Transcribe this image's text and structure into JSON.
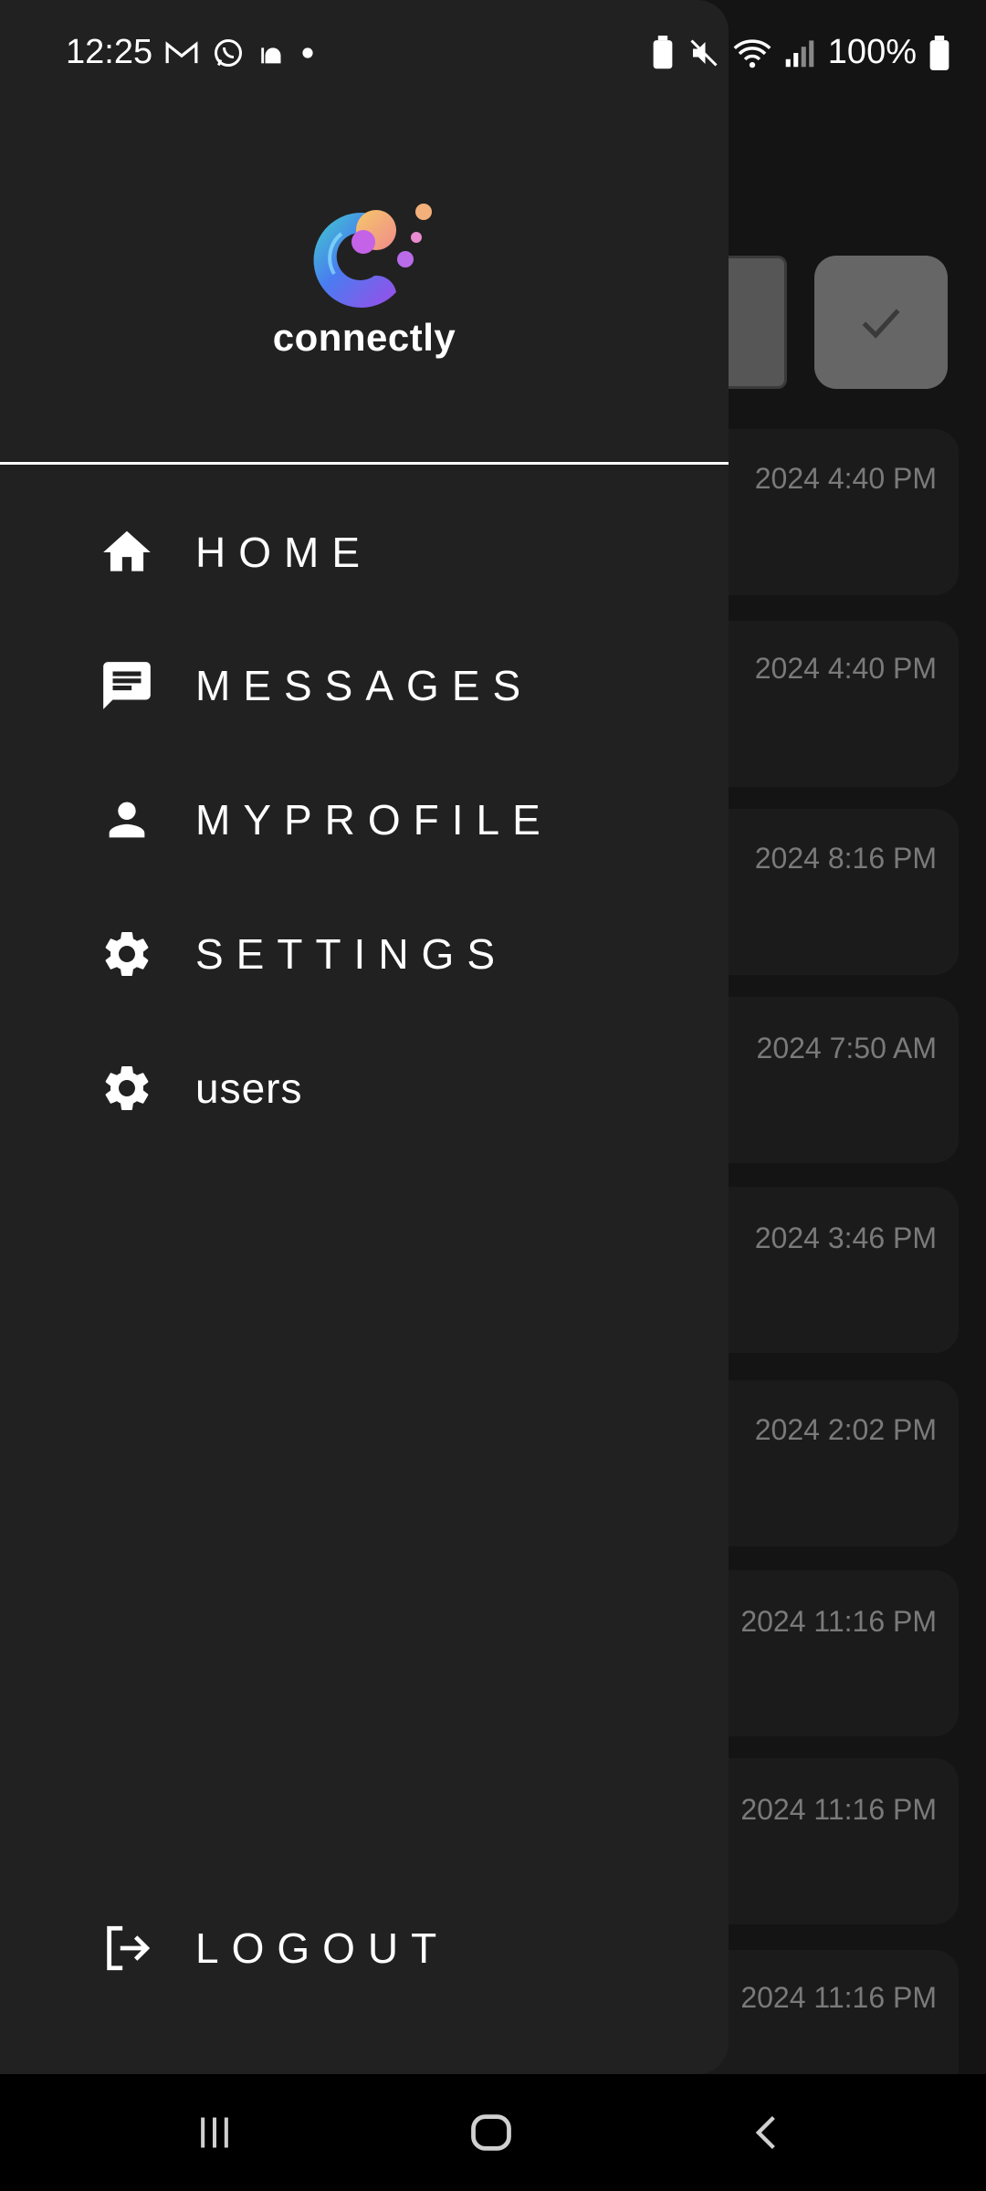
{
  "status_bar": {
    "time": "12:25",
    "left_icons": [
      "gmail-icon",
      "whatsapp-icon",
      "mosque-icon",
      "dot-icon"
    ],
    "right_icons": [
      "battery-saver-icon",
      "mute-icon",
      "wifi-icon",
      "signal-icon"
    ],
    "battery_text": "100%"
  },
  "drawer": {
    "logo_text": "connectly",
    "items": [
      {
        "label": "HOME",
        "icon": "home-icon"
      },
      {
        "label": "MESSAGES",
        "icon": "message-icon"
      },
      {
        "label": "MYPROFILE",
        "icon": "person-icon"
      },
      {
        "label": "SETTINGS",
        "icon": "gear-icon"
      },
      {
        "label": "users",
        "icon": "gear-icon"
      }
    ],
    "logout_label": "LOGOUT"
  },
  "background": {
    "timestamps": [
      "2024 4:40 PM",
      "2024 4:40 PM",
      "2024 8:16 PM",
      "2024 7:50 AM",
      "2024 3:46 PM",
      "2024 2:02 PM",
      "2024 11:16 PM",
      "2024 11:16 PM",
      "2024 11:16 PM"
    ]
  },
  "colors": {
    "drawer_bg": "#212121",
    "screen_bg": "#131313",
    "text": "#ffffff",
    "muted_time": "#7a7a7a"
  }
}
